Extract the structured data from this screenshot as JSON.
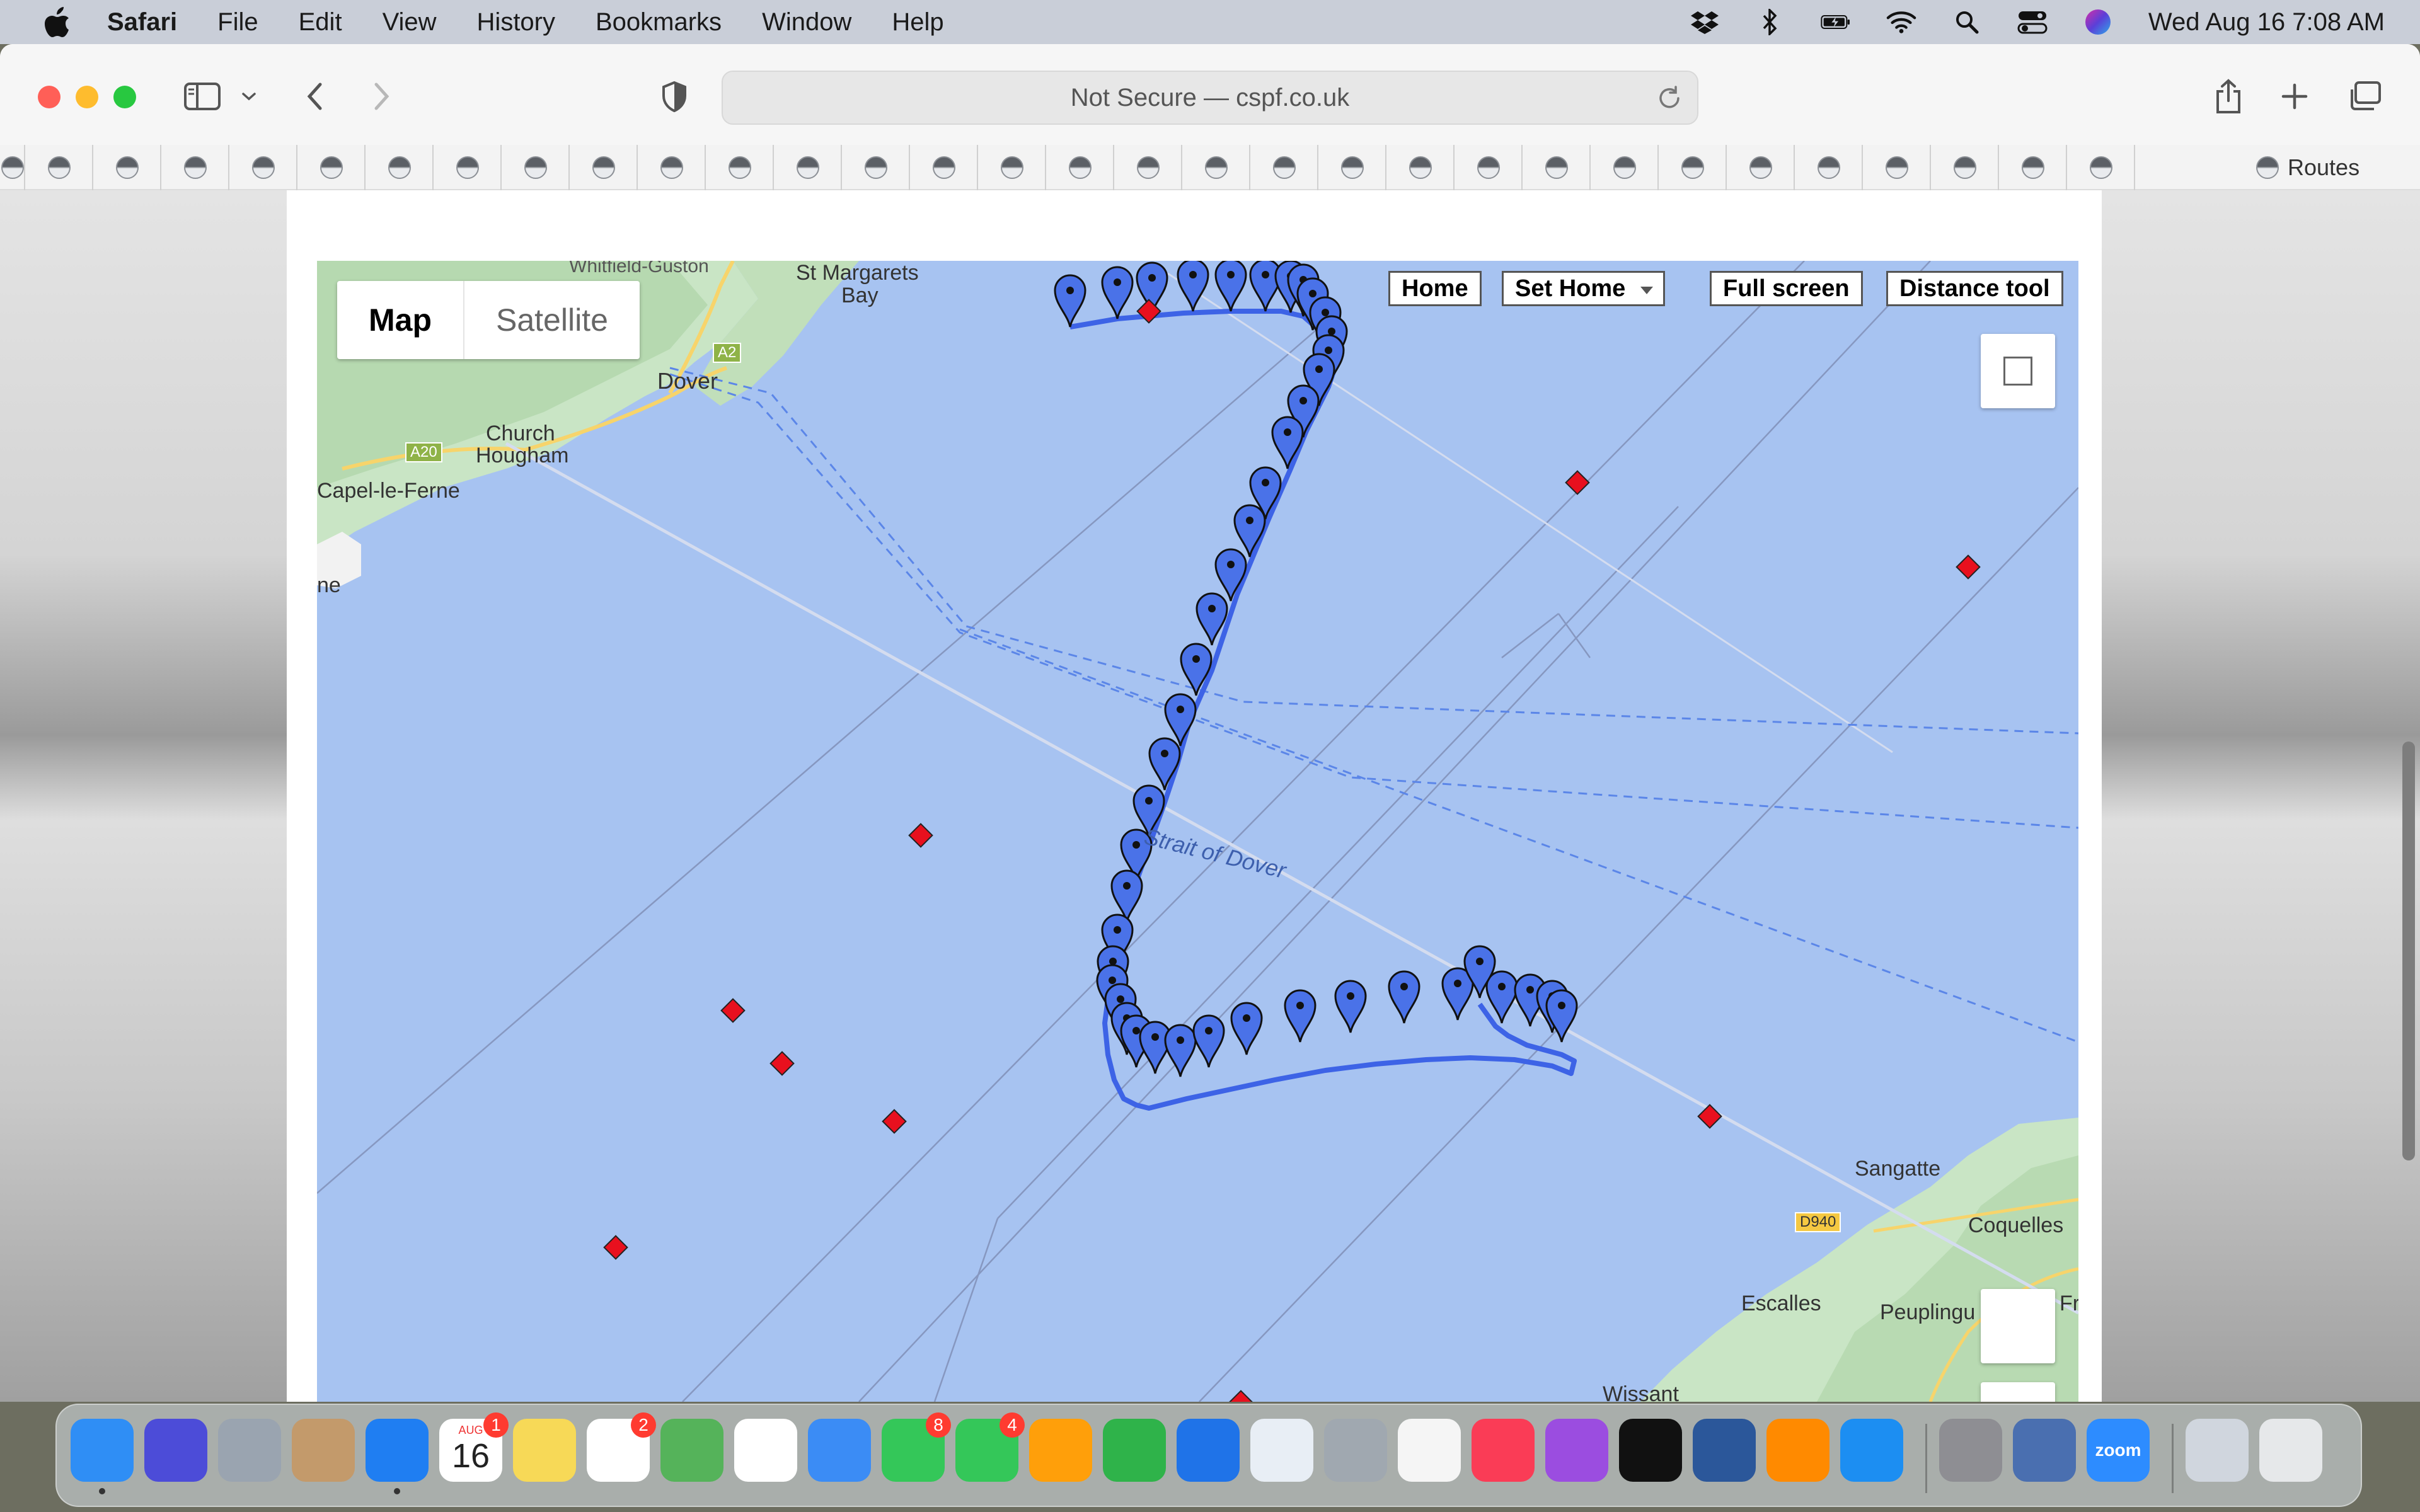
{
  "menubar": {
    "app_name": "Safari",
    "menus": [
      "File",
      "Edit",
      "View",
      "History",
      "Bookmarks",
      "Window",
      "Help"
    ],
    "clock": "Wed Aug 16  7:08 AM",
    "status_icons": [
      "dropbox-icon",
      "bluetooth-icon",
      "battery-icon",
      "wifi-icon",
      "spotlight-icon",
      "control-center-icon",
      "siri-icon"
    ]
  },
  "browser": {
    "address": "Not Secure — cspf.co.uk",
    "bookmark_count": 32,
    "routes_label": "Routes"
  },
  "map": {
    "type_buttons": [
      "Map",
      "Satellite"
    ],
    "controls": [
      "Home",
      "Set Home",
      "Full screen",
      "Distance tool"
    ],
    "labels": {
      "st_margarets": "St Margarets",
      "bay": "Bay",
      "dover": "Dover",
      "church": "Church",
      "hougham": "Hougham",
      "capel": "Capel-le-Ferne",
      "ne": "ne",
      "a2": "A2",
      "a20": "A20",
      "strait": "Strait of Dover",
      "sangatte": "Sangatte",
      "coquelles": "Coquelles",
      "escalles": "Escalles",
      "peuplingues": "Peuplingu",
      "fre": "Fre",
      "d940": "D940",
      "wissant": "Wissant",
      "whitfield": "Whitfield-Guston"
    },
    "track_color": "#3d63e6",
    "marker_color": "#e8101e"
  },
  "dock": {
    "apps": [
      "Finder",
      "Siri",
      "Launchpad",
      "Contacts",
      "Safari",
      "Calendar",
      "Notes",
      "Reminders",
      "Maps",
      "Photos",
      "Mail",
      "Messages",
      "FaceTime",
      "Pages",
      "Numbers",
      "Keynote",
      "Preview",
      "Image Capture",
      "News",
      "Music",
      "Podcasts",
      "TV",
      "Word",
      "Books",
      "App Store",
      "System Settings",
      "Screen Sharing",
      "Zoom",
      "Downloads",
      "Trash"
    ],
    "calendar_month": "AUG",
    "calendar_day": "16",
    "badges": {
      "calendar": "1",
      "reminders": "2",
      "messages": "8",
      "facetime": "4"
    },
    "zoom_label": "zoom"
  }
}
